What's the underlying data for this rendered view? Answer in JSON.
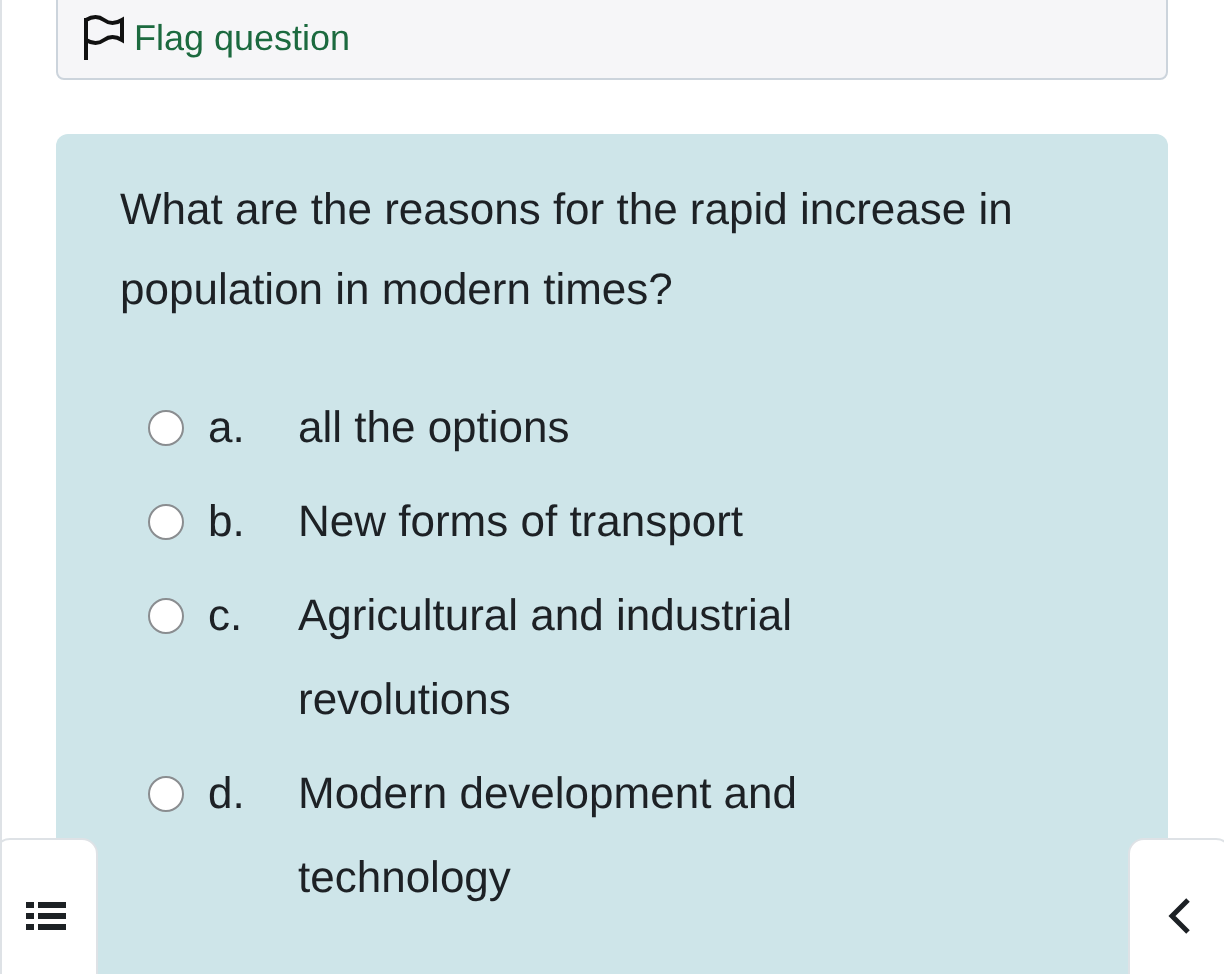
{
  "flag": {
    "label": "Flag question"
  },
  "question": {
    "text": "What are the reasons for the rapid increase in population in modern times?",
    "options": [
      {
        "letter": "a.",
        "text": "all the options",
        "selected": false
      },
      {
        "letter": "b.",
        "text": "New forms of transport",
        "selected": false
      },
      {
        "letter": "c.",
        "text": "Agricultural and industrial revolutions",
        "selected": false
      },
      {
        "letter": "d.",
        "text": "Modern development and technology",
        "selected": false
      }
    ]
  }
}
